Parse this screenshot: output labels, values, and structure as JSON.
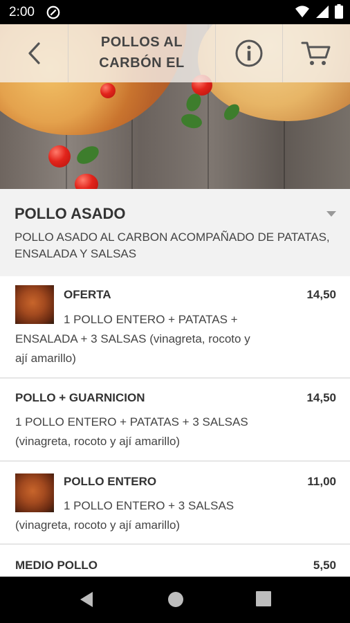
{
  "status": {
    "time": "2:00",
    "icons": [
      "wifi-icon",
      "signal-icon",
      "battery-icon"
    ]
  },
  "header": {
    "title_line1": "POLLOS AL",
    "title_line2": "CARBÓN EL",
    "back_icon": "chevron-left-icon",
    "info_icon": "info-icon",
    "cart_icon": "cart-icon"
  },
  "category": {
    "title": "POLLO ASADO",
    "description": "POLLO ASADO AL CARBON ACOMPAÑADO DE PATATAS, ENSALADA Y SALSAS"
  },
  "items": [
    {
      "title": "OFERTA",
      "price": "14,50",
      "desc_line1": "1 POLLO ENTERO + PATATAS +",
      "desc_line2": "ENSALADA + 3 SALSAS (vinagreta, rocoto y",
      "desc_line3": "ají amarillo)"
    },
    {
      "title": "POLLO + GUARNICION",
      "price": "14,50",
      "desc_line1": "1 POLLO ENTERO + PATATAS + 3 SALSAS",
      "desc_line2": "(vinagreta, rocoto y ají amarillo)"
    },
    {
      "title": "POLLO ENTERO",
      "price": "11,00",
      "desc_line1": "1 POLLO ENTERO + 3 SALSAS",
      "desc_line2": "(vinagreta, rocoto y ají amarillo)"
    },
    {
      "title": "MEDIO POLLO",
      "price": "5,50"
    }
  ],
  "colors": {
    "status_bar": "#000000",
    "category_bg": "#f2f2f2",
    "text": "#333333"
  }
}
